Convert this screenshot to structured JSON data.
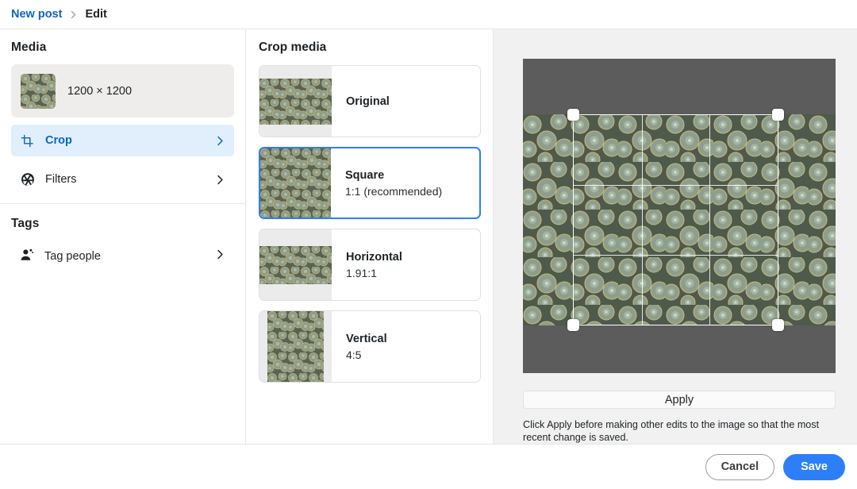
{
  "breadcrumb": {
    "parent_label": "New post",
    "separator_icon": "chevron-right-icon",
    "current_label": "Edit"
  },
  "sidebar": {
    "media_section": {
      "title": "Media",
      "thumbnail_icon": "media-thumbnail",
      "dimensions": "1200 × 1200"
    },
    "nav_items": [
      {
        "label": "Crop",
        "icon": "crop-icon",
        "chevron": "chevron-right-icon",
        "selected": true
      },
      {
        "label": "Filters",
        "icon": "aperture-icon",
        "chevron": "chevron-right-icon",
        "selected": false
      }
    ],
    "tags_section": {
      "title": "Tags",
      "items": [
        {
          "label": "Tag people",
          "icon": "tag-person-icon",
          "chevron": "chevron-right-icon"
        }
      ]
    }
  },
  "crop_panel": {
    "title": "Crop media",
    "options": [
      {
        "name": "Original",
        "ratio": "",
        "selected": false,
        "thumb_icon": "crop-preview-original"
      },
      {
        "name": "Square",
        "ratio": "1:1 (recommended)",
        "selected": true,
        "thumb_icon": "crop-preview-square"
      },
      {
        "name": "Horizontal",
        "ratio": "1.91:1",
        "selected": false,
        "thumb_icon": "crop-preview-horizontal"
      },
      {
        "name": "Vertical",
        "ratio": "4:5",
        "selected": false,
        "thumb_icon": "crop-preview-vertical"
      }
    ]
  },
  "preview": {
    "image_icon": "succulent-plants-photo",
    "crop_overlay_icon": "crop-overlay-grid",
    "handles": [
      "handle-top-left",
      "handle-top-right",
      "handle-bottom-left",
      "handle-bottom-right"
    ],
    "apply_label": "Apply",
    "note": "Click Apply before making other edits to the image so that the most recent change is saved."
  },
  "footer": {
    "cancel_label": "Cancel",
    "save_label": "Save"
  },
  "colors": {
    "accent_blue": "#0a66c2",
    "primary_button": "#2d7ff9",
    "selected_row_bg": "#e1effd",
    "panel_bg": "#f1f1f1",
    "image_mask": "#5c5c5c",
    "card_bg": "#eeedeb"
  }
}
